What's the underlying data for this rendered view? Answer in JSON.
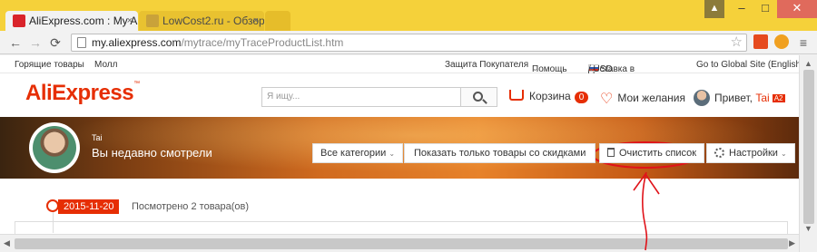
{
  "browser": {
    "tabs": [
      {
        "title": "AliExpress.com : My A",
        "close": "×"
      },
      {
        "title": "LowCost2.ru - Обзор",
        "close": "×"
      }
    ],
    "url_host": "my.aliexpress.com",
    "url_path": "/mytrace/myTraceProductList.htm",
    "nav": {
      "back": "←",
      "forward": "→",
      "reload": "⟳",
      "star": "☆",
      "menu": "≡"
    },
    "window": {
      "user": "▲",
      "minimize": "–",
      "maximize": "□",
      "close": "✕"
    }
  },
  "topnav": {
    "hot_deals": "Горящие товары",
    "mall": "Молл",
    "buyer_protection": "Защита Покупателя",
    "help": "Помощь",
    "ship_to": "Доставка в",
    "currency": "/ USD",
    "global": "Go to Global Site (English)",
    "caret": "⌄"
  },
  "header": {
    "logo": "AliExpress",
    "logo_tm": "™",
    "search_placeholder": "Я ищу...",
    "cart_label": "Корзина",
    "cart_count": "0",
    "wishlist_label": "Мои желания",
    "greeting": "Привет,",
    "user_name": "Tai",
    "level": "A2"
  },
  "banner": {
    "username": "Tai",
    "title": "Вы недавно смотрели",
    "categories_btn": "Все категории",
    "discount_btn": "Показать только товары со скидками",
    "clear_btn": "Очистить список",
    "settings_btn": "Настройки",
    "caret": "⌄"
  },
  "history": {
    "date": "2015-11-20",
    "viewed_count": "Посмотрено 2 товара(ов)"
  },
  "scroll": {
    "up": "▲",
    "down": "▼",
    "left": "◀",
    "right": "▶"
  },
  "colors": {
    "accent": "#e62e04",
    "annotation": "#e0131a",
    "chrome": "#f5d13a"
  }
}
